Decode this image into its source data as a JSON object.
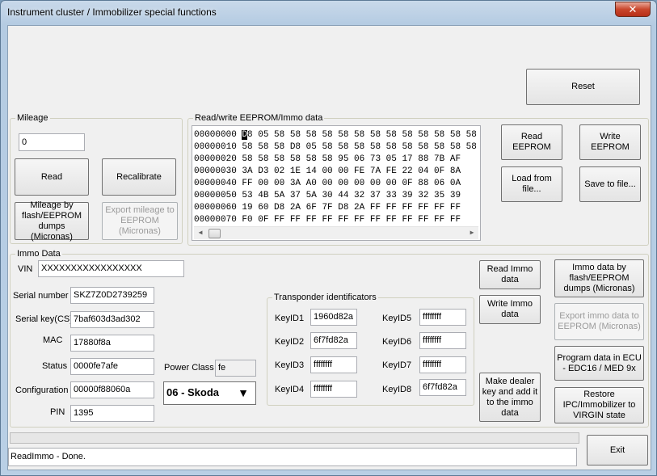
{
  "window": {
    "title": "Instrument cluster / Immobilizer special functions",
    "close_label": "✕"
  },
  "top": {
    "reset_label": "Reset"
  },
  "mileage": {
    "group_label": "Mileage",
    "value": "0",
    "read_label": "Read",
    "recalibrate_label": "Recalibrate",
    "flash_label": "Mileage by flash/EEPROM dumps (Micronas)",
    "export_label": "Export mileage to EEPROM (Micronas)"
  },
  "eeprom": {
    "group_label": "Read/write EEPROM/Immo data",
    "rows": [
      {
        "addr": "00000000",
        "first": "D",
        "rest": "8 05 58 58 58 58 58 58 58 58 58 58 58 58 58"
      },
      {
        "addr": "00000010",
        "first": "",
        "rest": "58 58 58 D8 05 58 58 58 58 58 58 58 58 58 58"
      },
      {
        "addr": "00000020",
        "first": "",
        "rest": "58 58 58 58 58 58 95 06 73 05 17 88 7B AF"
      },
      {
        "addr": "00000030",
        "first": "",
        "rest": "3A D3 02 1E 14 00 00 FE 7A FE 22 04 0F 8A"
      },
      {
        "addr": "00000040",
        "first": "",
        "rest": "FF 00 00 3A A0 00 00 00 00 00 0F 88 06 0A"
      },
      {
        "addr": "00000050",
        "first": "",
        "rest": "53 4B 5A 37 5A 30 44 32 37 33 39 32 35 39"
      },
      {
        "addr": "00000060",
        "first": "",
        "rest": "19 60 D8 2A 6F 7F D8 2A FF FF FF FF FF FF"
      },
      {
        "addr": "00000070",
        "first": "",
        "rest": "F0 0F FF FF FF FF FF FF FF FF FF FF FF FF"
      }
    ],
    "read_label": "Read EEPROM",
    "write_label": "Write EEPROM",
    "load_label": "Load from file...",
    "save_label": "Save to file..."
  },
  "immo": {
    "group_label": "Immo Data",
    "vin_label": "VIN",
    "vin_value": "XXXXXXXXXXXXXXXXX",
    "serial_label": "Serial number",
    "serial_value": "SKZ7Z0D2739259",
    "serialkey_label": "Serial key(CS)",
    "serialkey_value": "7baf603d3ad302",
    "mac_label": "MAC",
    "mac_value": "17880f8a",
    "status_label": "Status",
    "status_value": "0000fe7afe",
    "config_label": "Configuration",
    "config_value": "00000f88060a",
    "pin_label": "PIN",
    "pin_value": "1395",
    "power_label": "Power Class",
    "power_value": "fe",
    "brand_selected": "06 - Skoda",
    "transponder_label": "Transponder identificators",
    "keys": [
      {
        "label": "KeyID1",
        "value": "1960d82a"
      },
      {
        "label": "KeyID2",
        "value": "6f7fd82a"
      },
      {
        "label": "KeyID3",
        "value": "ffffffff"
      },
      {
        "label": "KeyID4",
        "value": "ffffffff"
      },
      {
        "label": "KeyID5",
        "value": "ffffffff"
      },
      {
        "label": "KeyID6",
        "value": "ffffffff"
      },
      {
        "label": "KeyID7",
        "value": "ffffffff"
      },
      {
        "label": "KeyID8",
        "value": "6f7fd82a"
      }
    ],
    "read_immo_label": "Read Immo data",
    "write_immo_label": "Write Immo data",
    "dealer_label": "Make dealer key and add it to the immo data",
    "immo_flash_label": "Immo data by flash/EEPROM dumps (Micronas)",
    "export_immo_label": "Export immo data to EEPROM (Micronas)",
    "program_ecu_label": "Program data in ECU - EDC16 / MED 9x",
    "restore_label": "Restore IPC/Immobilizer to VIRGIN state"
  },
  "footer": {
    "status_text": "ReadImmo - Done.",
    "exit_label": "Exit"
  }
}
